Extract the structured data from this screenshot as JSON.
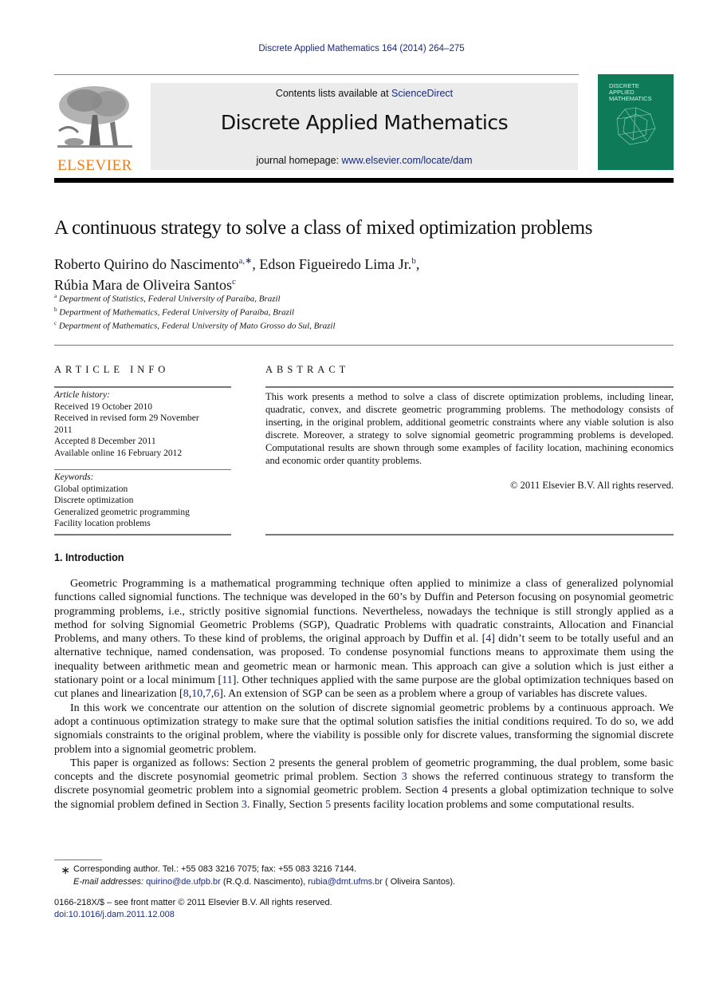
{
  "journal_ref": "Discrete Applied Mathematics 164 (2014) 264–275",
  "header": {
    "publisher_logo_label": "ELSEVIER",
    "contents_prefix": "Contents lists available at ",
    "contents_link": "ScienceDirect",
    "journal_title": "Discrete Applied Mathematics",
    "homepage_prefix": "journal homepage: ",
    "homepage_link": "www.elsevier.com/locate/dam",
    "cover": {
      "line1": "DISCRETE",
      "line2": "APPLIED",
      "line3": "MATHEMATICS",
      "color": "#0e7a58"
    }
  },
  "article": {
    "title": "A continuous strategy to solve a class of mixed optimization problems",
    "authors": [
      {
        "name": "Roberto Quirino do Nascimento",
        "sup": "a,∗",
        "sep": ", "
      },
      {
        "name": "Edson Figueiredo Lima Jr.",
        "sup": "b",
        "sep": ","
      },
      {
        "name": "Rúbia Mara de Oliveira Santos",
        "sup": "c",
        "sep": ""
      }
    ],
    "affiliations": [
      {
        "mark": "a",
        "text": "Department of Statistics, Federal University of Paraíba, Brazil"
      },
      {
        "mark": "b",
        "text": "Department of Mathematics, Federal University of Paraíba, Brazil"
      },
      {
        "mark": "c",
        "text": "Department of Mathematics, Federal University of Mato Grosso do Sul, Brazil"
      }
    ]
  },
  "article_info": {
    "heading": "ARTICLE INFO",
    "history_label": "Article history:",
    "history": [
      "Received 19 October 2010",
      "Received in revised form 29 November",
      "2011",
      "Accepted 8 December 2011",
      "Available online 16 February 2012"
    ],
    "keywords_label": "Keywords:",
    "keywords": [
      "Global optimization",
      "Discrete optimization",
      "Generalized geometric programming",
      "Facility location problems"
    ]
  },
  "abstract": {
    "heading": "ABSTRACT",
    "text": "This work presents a method to solve a class of discrete optimization problems, including linear, quadratic, convex, and discrete geometric programming problems. The methodology consists of inserting, in the original problem, additional geometric constraints where any viable solution is also discrete. Moreover, a strategy to solve signomial geometric programming problems is developed. Computational results are shown through some examples of facility location, machining economics and economic order quantity problems.",
    "copyright": "© 2011 Elsevier B.V. All rights reserved."
  },
  "introduction": {
    "heading": "1.  Introduction",
    "p1": {
      "t1": "Geometric Programming is a mathematical programming technique often applied to minimize a class of generalized polynomial functions called signomial functions. The technique was developed in the 60’s by Duffin and Peterson focusing on posynomial geometric programming problems, i.e., strictly positive signomial functions. Nevertheless, nowadays the technique is still strongly applied as a method for solving Signomial Geometric Problems (SGP), Quadratic Problems with quadratic constraints, Allocation and Financial Problems, and many others. To these kind of problems, the original approach by Duffin et al. [",
      "ref1": "4",
      "t2": "] didn’t seem to be totally useful and an alternative technique, named condensation, was proposed. To condense posynomial functions means to approximate them using the inequality between arithmetic mean and geometric mean or harmonic mean. This approach can give a solution which is just either a stationary point or a local minimum [",
      "ref2": "11",
      "t3": "]. Other techniques applied with the same purpose are the global optimization techniques based on cut planes and linearization [",
      "ref3": "8",
      "ref4": "10",
      "ref5": "7",
      "ref6": "6",
      "t4": "]. An extension of SGP can be seen as a problem where a group of variables has discrete values."
    },
    "p2": "In this work we concentrate our attention on the solution of discrete signomial geometric problems by a continuous approach. We adopt a continuous optimization strategy to make sure that the optimal solution satisfies the initial conditions required. To do so, we add signomials constraints to the original problem, where the viability is possible only for discrete values, transforming the signomial discrete problem into a signomial geometric problem.",
    "p3": {
      "t1": "This paper is organized as follows: Section ",
      "s2": "2",
      "t2": " presents the general problem of geometric programming, the dual problem, some basic concepts and the discrete posynomial geometric primal problem. Section ",
      "s3": "3",
      "t3": " shows the referred continuous strategy to transform the discrete posynomial geometric problem into a signomial geometric problem. Section ",
      "s4": "4",
      "t4": " presents a global optimization technique to solve the signomial problem defined in Section ",
      "s3b": "3",
      "t5": ". Finally, Section ",
      "s5": "5",
      "t6": " presents facility location problems and some computational results."
    }
  },
  "footnotes": {
    "star": "∗",
    "corresponding": "Corresponding author. Tel.: +55 083 3216 7075; fax: +55 083 3216 7144.",
    "email_label": "E-mail addresses:",
    "email1": "quirino@de.ufpb.br",
    "email1_name": " (R.Q.d. Nascimento), ",
    "email2": "rubia@dmt.ufms.br",
    "email2_name": " ( Oliveira Santos)."
  },
  "front_matter": {
    "issn_line": "0166-218X/$ – see front matter © 2011 Elsevier B.V. All rights reserved.",
    "doi": "doi:10.1016/j.dam.2011.12.008"
  }
}
